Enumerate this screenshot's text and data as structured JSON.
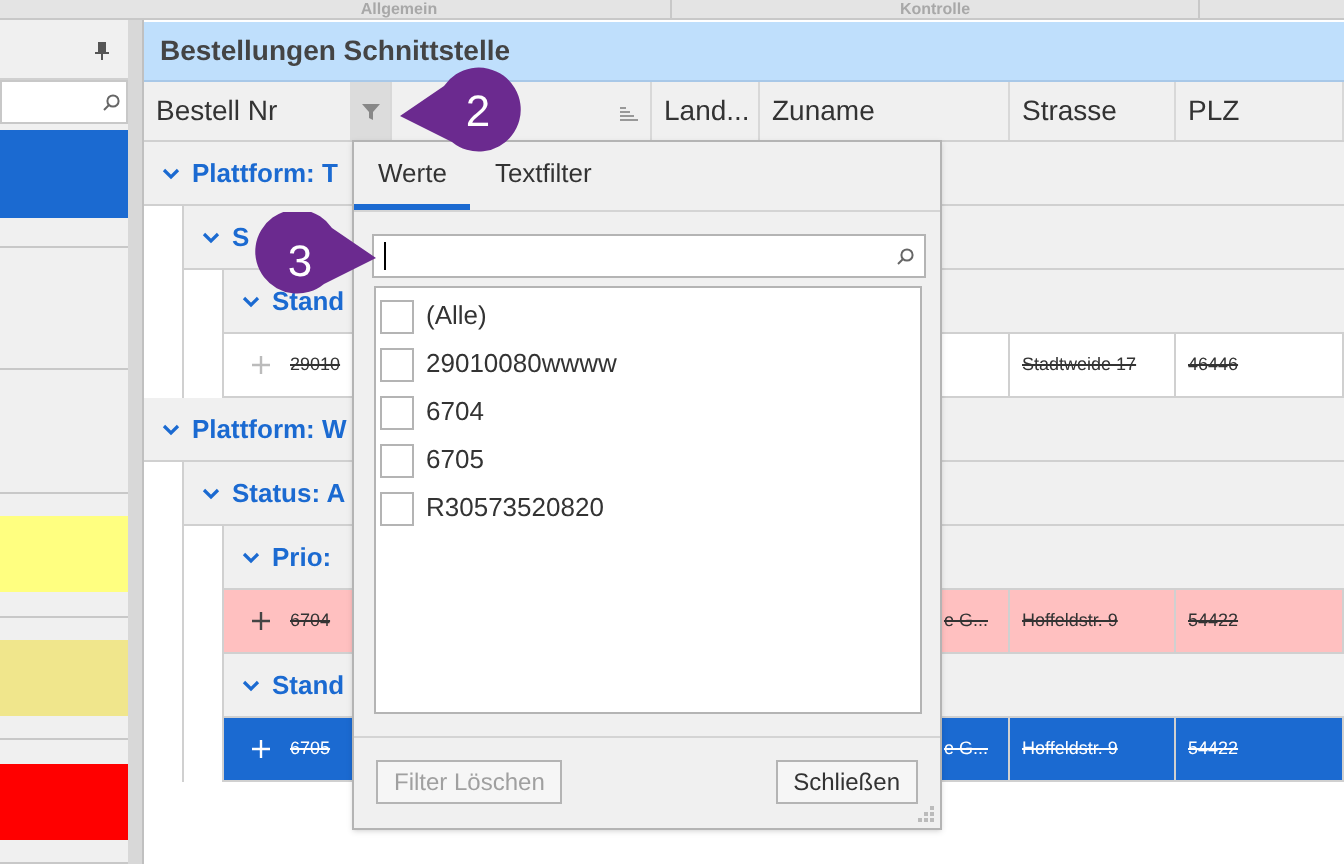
{
  "top_tabs": [
    {
      "label": "Allgemein"
    },
    {
      "label": "Kontrolle"
    }
  ],
  "left_panel": {
    "items": [
      {
        "kind": "swatch",
        "color": "#1b6ad1"
      },
      {
        "kind": "plain"
      },
      {
        "kind": "plain"
      },
      {
        "kind": "swatch",
        "color": "#ffff80"
      },
      {
        "kind": "swatch",
        "color": "#f0e68c"
      },
      {
        "kind": "swatch",
        "color": "#ff0000"
      }
    ]
  },
  "grid": {
    "title": "Bestellungen Schnittstelle",
    "columns": [
      {
        "label": "Bestell Nr",
        "filter_open": true
      },
      {
        "sort_icon": true
      },
      {
        "label": "Land..."
      },
      {
        "label": "Zuname"
      },
      {
        "label": "Strasse"
      },
      {
        "label": "PLZ"
      }
    ],
    "groups": [
      {
        "kind": "group",
        "label": "Plattform: T",
        "expanded": true,
        "children": [
          {
            "kind": "group",
            "label": "S",
            "expanded": true,
            "children": [
              {
                "kind": "group",
                "label": "Stand",
                "expanded": true,
                "children": [
                  {
                    "kind": "record",
                    "bestell_nr": "29010",
                    "strasse": "Stadtweide 17",
                    "plz": "46446",
                    "deleted": true,
                    "selected": false,
                    "color": "#ffffff"
                  }
                ]
              }
            ]
          }
        ]
      },
      {
        "kind": "group",
        "label": "Plattform: W",
        "expanded": true,
        "children": [
          {
            "kind": "group",
            "label": "Status: A",
            "expanded": true,
            "children": [
              {
                "kind": "group",
                "label": "Prio:",
                "expanded": true,
                "children": [
                  {
                    "kind": "record",
                    "bestell_nr": "6704",
                    "zuname": "e G...",
                    "strasse": "Hoffeldstr. 9",
                    "plz": "54422",
                    "deleted": true,
                    "selected": false,
                    "color": "#ffc0c0"
                  }
                ]
              },
              {
                "kind": "group",
                "label": "Stand",
                "expanded": true,
                "children": [
                  {
                    "kind": "record",
                    "bestell_nr": "6705",
                    "zuname": "e G...",
                    "strasse": "Hoffeldstr. 9",
                    "plz": "54422",
                    "deleted": true,
                    "selected": true
                  }
                ]
              }
            ]
          }
        ]
      }
    ]
  },
  "filter_popup": {
    "tabs": [
      {
        "label": "Werte",
        "selected": true
      },
      {
        "label": "Textfilter",
        "selected": false
      }
    ],
    "search": {
      "focused": true
    },
    "values": [
      {
        "label": "(Alle)",
        "checked": false
      },
      {
        "label": "29010080wwww",
        "checked": false
      },
      {
        "label": "6704",
        "checked": false
      },
      {
        "label": "6705",
        "checked": false
      },
      {
        "label": "R30573520820",
        "checked": false
      }
    ],
    "buttons": [
      {
        "label": "Filter Löschen",
        "disabled": true
      },
      {
        "label": "Schließen",
        "disabled": false
      }
    ]
  },
  "callouts": [
    {
      "number": "2"
    },
    {
      "number": "3"
    }
  ]
}
